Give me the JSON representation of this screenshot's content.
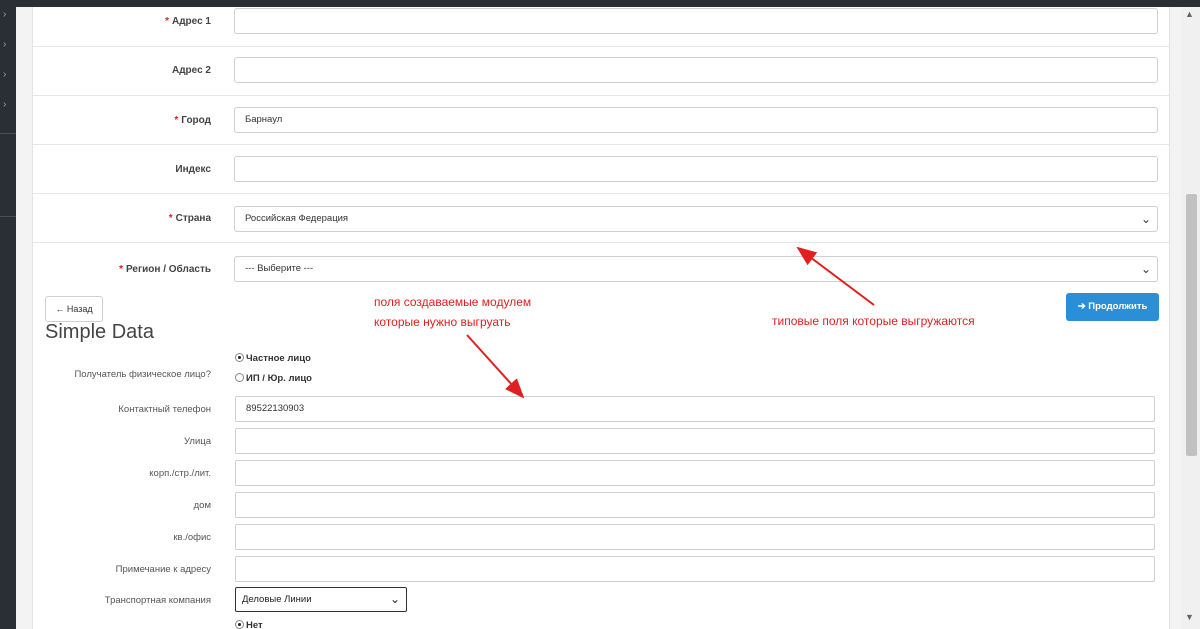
{
  "address_form": {
    "address1": {
      "label": "Адрес 1",
      "required": true,
      "value": ""
    },
    "address2": {
      "label": "Адрес 2",
      "required": false,
      "value": ""
    },
    "city": {
      "label": "Город",
      "required": true,
      "value": "Барнаул"
    },
    "postcode": {
      "label": "Индекс",
      "required": false,
      "value": ""
    },
    "country": {
      "label": "Страна",
      "required": true,
      "value": "Российская Федерация"
    },
    "region": {
      "label": "Регион / Область",
      "required": true,
      "value": "--- Выберите ---"
    },
    "required_mark": "*"
  },
  "buttons": {
    "back": "Назад",
    "back_icon": "←",
    "continue": "Продолжить",
    "continue_icon": "➔"
  },
  "simple_data": {
    "title": "Simple Data",
    "recipient_type": {
      "label": "Получатель физическое лицо?",
      "options": [
        "Частное лицо",
        "ИП / Юр. лицо"
      ],
      "selected": "Частное лицо"
    },
    "phone": {
      "label": "Контактный телефон",
      "value": "89522130903"
    },
    "street": {
      "label": "Улица",
      "value": ""
    },
    "building": {
      "label": "корп./стр./лит.",
      "value": ""
    },
    "house": {
      "label": "дом",
      "value": ""
    },
    "apartment": {
      "label": "кв./офис",
      "value": ""
    },
    "address_note": {
      "label": "Примечание к адресу",
      "value": ""
    },
    "transport": {
      "label": "Транспортная компания",
      "value": "Деловые Линии"
    },
    "next_radio": {
      "value": "Нет"
    }
  },
  "annotations": {
    "module_fields_line1": "поля создаваемые модулем",
    "module_fields_line2": "которые нужно выгруать",
    "standard_fields": "типовые поля которые выгружаются"
  },
  "colors": {
    "accent_button": "#2a8fd6",
    "required": "#e02020",
    "annotation": "#e02020",
    "sidebar": "#2a2f35"
  }
}
